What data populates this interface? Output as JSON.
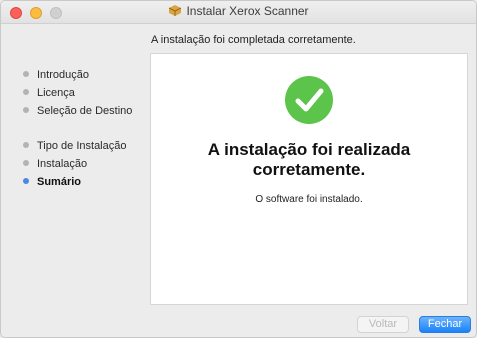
{
  "window": {
    "title": "Instalar Xerox Scanner"
  },
  "subtitle": "A instalação foi completada corretamente.",
  "steps": [
    {
      "label": "Introdução",
      "active": false
    },
    {
      "label": "Licença",
      "active": false
    },
    {
      "label": "Seleção de Destino",
      "active": false
    },
    {
      "label": "Tipo de Instalação",
      "active": false
    },
    {
      "label": "Instalação",
      "active": false
    },
    {
      "label": "Sumário",
      "active": true
    }
  ],
  "content": {
    "headline_line1": "A instalação foi realizada",
    "headline_line2": "corretamente.",
    "message": "O software foi instalado.",
    "status_icon": "success-check-icon"
  },
  "buttons": {
    "back_label": "Voltar",
    "back_enabled": false,
    "close_label": "Fechar"
  },
  "colors": {
    "accent": "#1a82fb",
    "success": "#5cc44a",
    "active_step": "#4c86e8"
  }
}
